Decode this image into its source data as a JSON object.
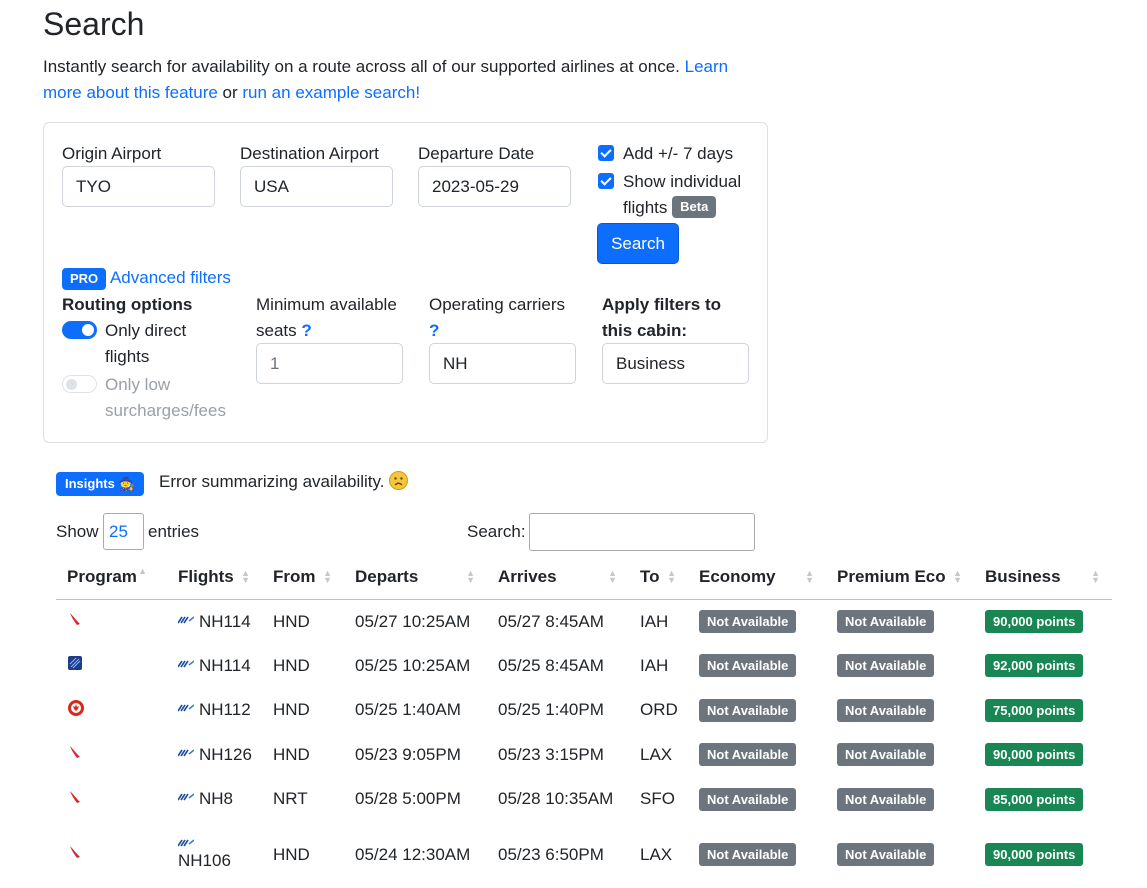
{
  "page": {
    "title": "Search",
    "intro_text": "Instantly search for availability on a route across all of our supported airlines at once. ",
    "learn_link": "Learn more about this feature",
    "or_text": " or ",
    "example_link": "run an example search!"
  },
  "form": {
    "origin_label": "Origin Airport",
    "origin_value": "TYO",
    "destination_label": "Destination Airport",
    "destination_value": "USA",
    "date_label": "Departure Date",
    "date_value": "2023-05-29",
    "add_days_label": "Add +/- 7 days",
    "show_flights_label_1": "Show individual",
    "show_flights_label_2": "flights",
    "beta_badge": "Beta",
    "search_button": "Search"
  },
  "advanced": {
    "pro_badge": "PRO",
    "link": "Advanced filters",
    "routing_heading": "Routing options",
    "direct_label_1": "Only direct",
    "direct_label_2": "flights",
    "low_fees_label_1": "Only low",
    "low_fees_label_2": "surcharges/fees",
    "min_seats_label_1": "Minimum available",
    "min_seats_label_2": "seats",
    "help_mark": "?",
    "min_seats_value": "1",
    "carriers_label": "Operating carriers",
    "carriers_value": "NH",
    "cabin_label_1": "Apply filters to",
    "cabin_label_2": "this cabin:",
    "cabin_value": "Business"
  },
  "insights": {
    "badge": "Insights",
    "message": "Error summarizing availability."
  },
  "table_controls": {
    "show_label": "Show",
    "entries_value": "25",
    "entries_label": "entries",
    "search_label": "Search:"
  },
  "table": {
    "headers": [
      "Program",
      "Flights",
      "From",
      "Departs",
      "Arrives",
      "To",
      "Economy",
      "Premium Eco",
      "Business"
    ],
    "rows": [
      {
        "program_icon": "red-bird-icon",
        "flight": "NH114",
        "from": "HND",
        "departs": "05/27 10:25AM",
        "arrives": "05/27 8:45AM",
        "to": "IAH",
        "economy": "Not Available",
        "premium": "Not Available",
        "business": "90,000 points"
      },
      {
        "program_icon": "blue-square-icon",
        "flight": "NH114",
        "from": "HND",
        "departs": "05/25 10:25AM",
        "arrives": "05/25 8:45AM",
        "to": "IAH",
        "economy": "Not Available",
        "premium": "Not Available",
        "business": "92,000 points"
      },
      {
        "program_icon": "maple-leaf-icon",
        "flight": "NH112",
        "from": "HND",
        "departs": "05/25 1:40AM",
        "arrives": "05/25 1:40PM",
        "to": "ORD",
        "economy": "Not Available",
        "premium": "Not Available",
        "business": "75,000 points"
      },
      {
        "program_icon": "red-bird-icon",
        "flight": "NH126",
        "from": "HND",
        "departs": "05/23 9:05PM",
        "arrives": "05/23 3:15PM",
        "to": "LAX",
        "economy": "Not Available",
        "premium": "Not Available",
        "business": "90,000 points"
      },
      {
        "program_icon": "red-bird-icon",
        "flight": "NH8",
        "from": "NRT",
        "departs": "05/28 5:00PM",
        "arrives": "05/28 10:35AM",
        "to": "SFO",
        "economy": "Not Available",
        "premium": "Not Available",
        "business": "85,000 points"
      },
      {
        "program_icon": "red-bird-icon",
        "flight": "NH106",
        "from": "HND",
        "departs": "05/24 12:30AM",
        "arrives": "05/23 6:50PM",
        "to": "LAX",
        "economy": "Not Available",
        "premium": "Not Available",
        "business": "90,000 points"
      }
    ]
  },
  "colors": {
    "primary": "#0d6efd",
    "not_available": "#6c757d",
    "points": "#198754",
    "ana_blue": "#1d4e9e",
    "bird_red": "#d7262e",
    "maple_red": "#d52b1e"
  }
}
